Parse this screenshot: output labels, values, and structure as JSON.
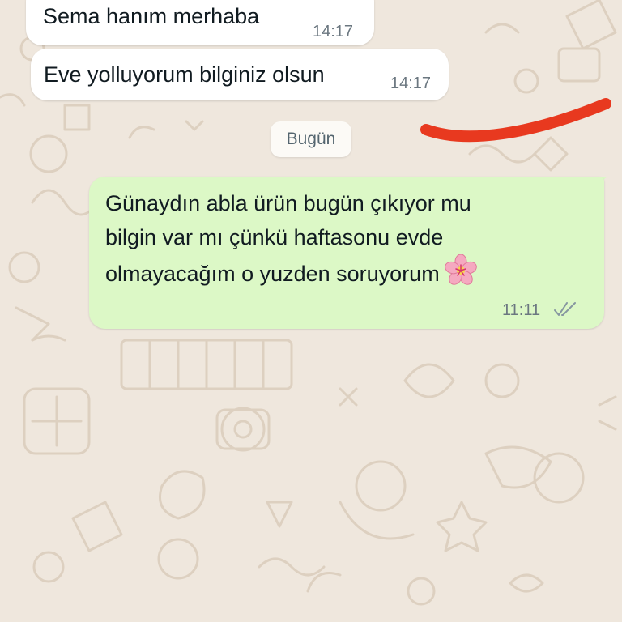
{
  "chat": {
    "messages": [
      {
        "direction": "incoming",
        "text": "Sema hanım merhaba",
        "time": "14:17"
      },
      {
        "direction": "incoming",
        "text": "Eve yolluyorum bilginiz olsun",
        "time": "14:17"
      },
      {
        "direction": "outgoing",
        "lines": [
          "Günaydın abla ürün bugün çıkıyor mu",
          "bilgin var mı çünkü haftasonu evde",
          "olmayacağım o yuzden soruyorum"
        ],
        "emoji": "cherry-blossom-emoji",
        "time": "11:11",
        "status": "read-double-check"
      }
    ],
    "date_separator": "Bugün"
  },
  "colors": {
    "wallpaper": "#efe7dd",
    "doodle": "#ddd0c0",
    "incoming_bubble": "#ffffff",
    "outgoing_bubble": "#dcf8c6",
    "annotation_stroke": "#e8391f"
  }
}
